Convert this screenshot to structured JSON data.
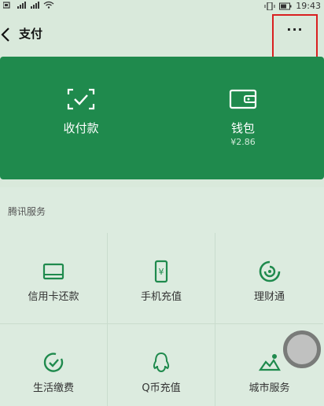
{
  "status_bar": {
    "time": "19:43"
  },
  "header": {
    "title": "支付",
    "more_label": "···"
  },
  "wallet_card": {
    "items": [
      {
        "label": "收付款",
        "sub": ""
      },
      {
        "label": "钱包",
        "sub": "¥2.86"
      }
    ]
  },
  "services": {
    "section_title": "腾讯服务",
    "items": [
      {
        "label": "信用卡还款"
      },
      {
        "label": "手机充值"
      },
      {
        "label": "理财通"
      },
      {
        "label": "生活缴费"
      },
      {
        "label": "Q币充值"
      },
      {
        "label": "城市服务"
      }
    ]
  },
  "colors": {
    "accent": "#1f8a4d",
    "highlight_box": "#d92020"
  }
}
